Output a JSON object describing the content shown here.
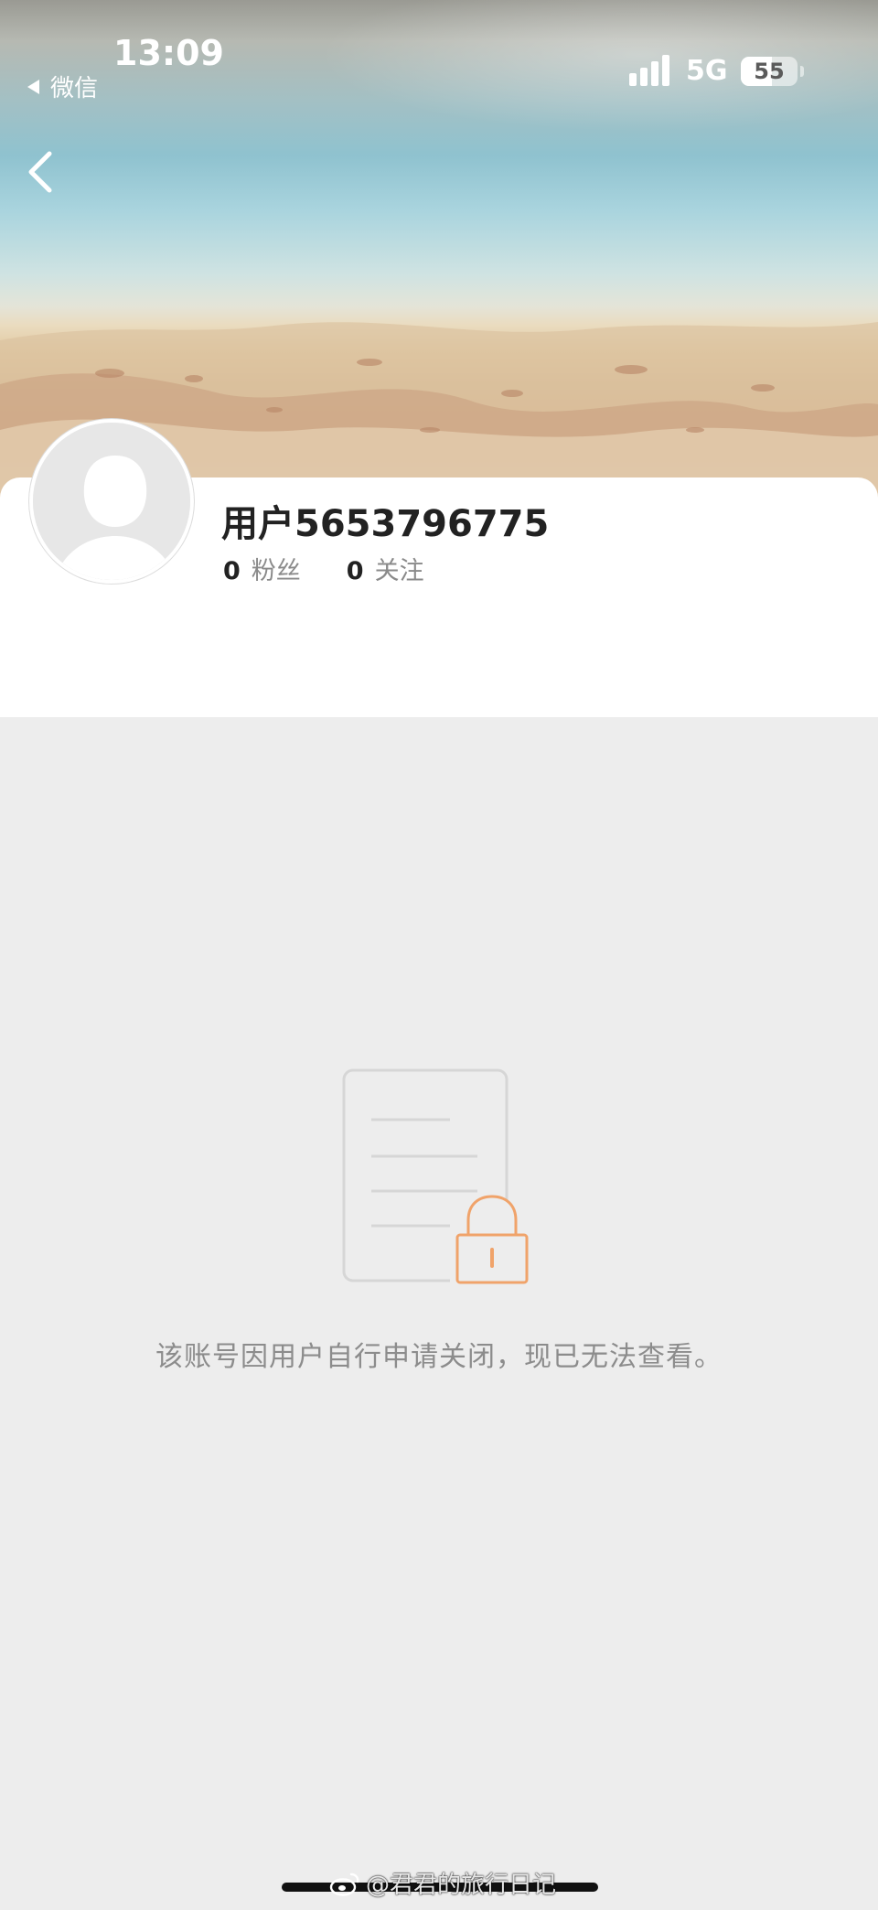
{
  "status_bar": {
    "time": "13:09",
    "back_app": "微信",
    "network": "5G",
    "battery_level": "55",
    "battery_fraction": 0.55
  },
  "nav": {
    "back_icon": "chevron-left-icon"
  },
  "profile": {
    "username": "用户5653796775",
    "stats": [
      {
        "value": "0",
        "label": "粉丝"
      },
      {
        "value": "0",
        "label": "关注"
      }
    ],
    "avatar_icon": "default-avatar-icon"
  },
  "notice": {
    "icon": "locked-document-icon",
    "message": "该账号因用户自行申请关闭，现已无法查看。"
  },
  "watermark": {
    "text": "@君君的旅行日记"
  },
  "colors": {
    "accent_orange": "#f0a36a",
    "page_background": "#ededed",
    "card_background": "#ffffff",
    "muted_text": "#8c8c8c"
  }
}
